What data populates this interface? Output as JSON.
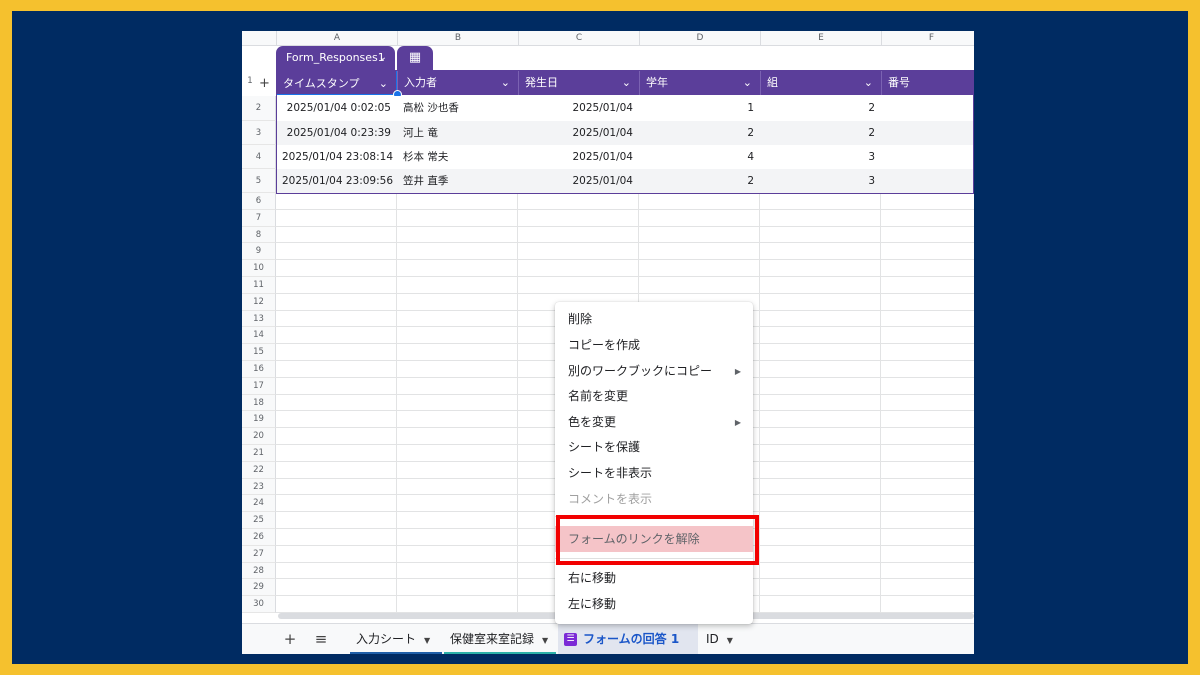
{
  "columns": [
    "A",
    "B",
    "C",
    "D",
    "E",
    "F"
  ],
  "table": {
    "name": "Form_Responses1",
    "headers": [
      "タイムスタンプ",
      "入力者",
      "発生日",
      "学年",
      "組",
      "番号"
    ],
    "rows": [
      {
        "row": "2",
        "cells": [
          "2025/01/04 0:02:05",
          "高松 沙也香",
          "2025/01/04",
          "1",
          "2",
          ""
        ]
      },
      {
        "row": "3",
        "cells": [
          "2025/01/04 0:23:39",
          "河上 竜",
          "2025/01/04",
          "2",
          "2",
          ""
        ]
      },
      {
        "row": "4",
        "cells": [
          "2025/01/04 23:08:14",
          "杉本 常夫",
          "2025/01/04",
          "4",
          "3",
          ""
        ]
      },
      {
        "row": "5",
        "cells": [
          "2025/01/04 23:09:56",
          "笠井 直季",
          "2025/01/04",
          "2",
          "3",
          ""
        ]
      }
    ]
  },
  "first_row_number": "1",
  "empty_rows": [
    "6",
    "7",
    "8",
    "9",
    "10",
    "11",
    "12",
    "13",
    "14",
    "15",
    "16",
    "17",
    "18",
    "19",
    "20",
    "21",
    "22",
    "23",
    "24",
    "25",
    "26",
    "27",
    "28",
    "29",
    "30"
  ],
  "context_menu": {
    "items": [
      {
        "label": "削除",
        "submenu": false,
        "disabled": false
      },
      {
        "label": "コピーを作成",
        "submenu": false,
        "disabled": false
      },
      {
        "label": "別のワークブックにコピー",
        "submenu": true,
        "disabled": false
      },
      {
        "label": "名前を変更",
        "submenu": false,
        "disabled": false
      },
      {
        "label": "色を変更",
        "submenu": true,
        "disabled": false
      },
      {
        "label": "シートを保護",
        "submenu": false,
        "disabled": false
      },
      {
        "label": "シートを非表示",
        "submenu": false,
        "disabled": false
      },
      {
        "label": "コメントを表示",
        "submenu": false,
        "disabled": true
      },
      {
        "label": "フォームのリンクを解除",
        "submenu": false,
        "disabled": false,
        "highlighted": true
      },
      {
        "label": "右に移動",
        "submenu": false,
        "disabled": false
      },
      {
        "label": "左に移動",
        "submenu": false,
        "disabled": false
      }
    ],
    "submenu_arrow": "▶"
  },
  "sheet_tabs": [
    {
      "label": "入力シート",
      "active": false,
      "underline": "#1f5fa8"
    },
    {
      "label": "保健室来室記録",
      "active": false,
      "underline": "#2bb0a8"
    },
    {
      "label": "フォームの回答 1",
      "active": true,
      "underline": ""
    },
    {
      "label": "ID",
      "active": false,
      "underline": ""
    }
  ],
  "icons": {
    "add_sheet": "+",
    "all_sheets": "≡",
    "dropdown": "⌄",
    "table_view": "▦",
    "caret": "▼",
    "form": "☰",
    "row_add": "+"
  },
  "colors": {
    "frame": "#f5c12e",
    "background": "#002b62",
    "table_header": "#5b3e9a",
    "highlight_box": "#f20000",
    "selection": "#1a73e8"
  }
}
